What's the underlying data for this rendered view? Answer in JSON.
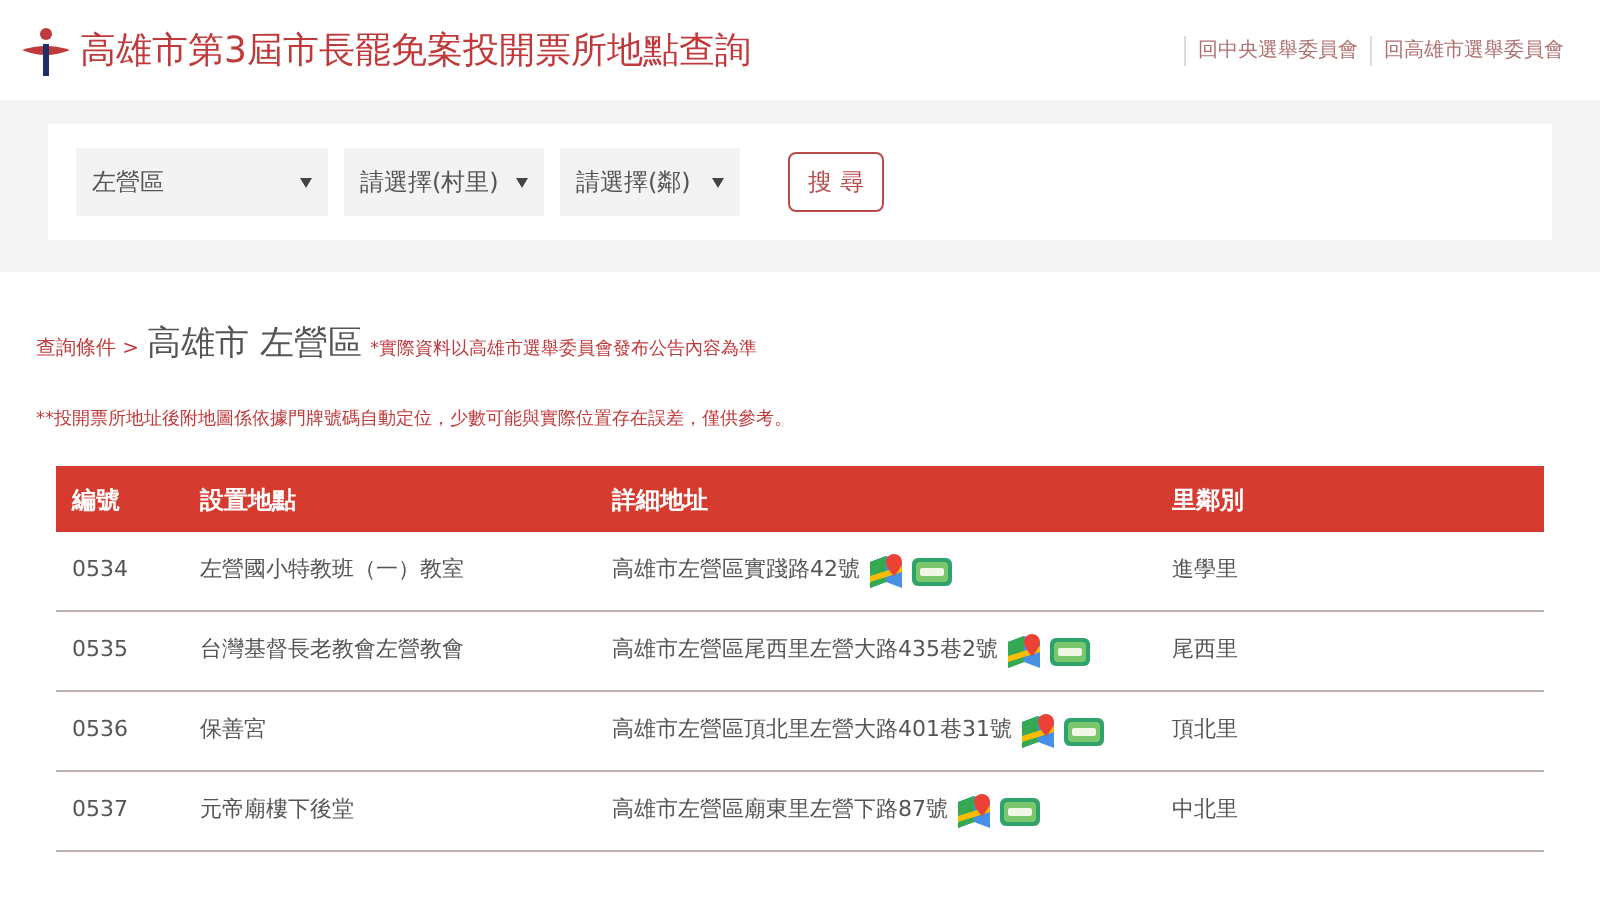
{
  "header": {
    "title": "高雄市第3屆市長罷免案投開票所地點查詢",
    "links": [
      "回中央選舉委員會",
      "回高雄市選舉委員會"
    ]
  },
  "search": {
    "selects": [
      "左營區",
      "請選擇(村里)",
      "請選擇(鄰)"
    ],
    "button": "搜 尋"
  },
  "breadcrumb": {
    "label": "查詢條件 >",
    "location": "高雄市 左營區",
    "note": "*實際資料以高雄市選舉委員會發布公告內容為準"
  },
  "notice": "**投開票所地址後附地圖係依據門牌號碼自動定位，少數可能與實際位置存在誤差，僅供參考。",
  "table": {
    "columns": [
      "編號",
      "設置地點",
      "詳細地址",
      "里鄰別"
    ],
    "rows": [
      {
        "number": "0534",
        "place": "左營國小特教班（一）教室",
        "address": "高雄市左營區實踐路42號",
        "village": "進學里"
      },
      {
        "number": "0535",
        "place": "台灣基督長老教會左營教會",
        "address": "高雄市左營區尾西里左營大路435巷2號",
        "village": "尾西里"
      },
      {
        "number": "0536",
        "place": "保善宮",
        "address": "高雄市左營區頂北里左營大路401巷31號",
        "village": "頂北里"
      },
      {
        "number": "0537",
        "place": "元帝廟樓下後堂",
        "address": "高雄市左營區廟東里左營下路87號",
        "village": "中北里"
      }
    ]
  }
}
